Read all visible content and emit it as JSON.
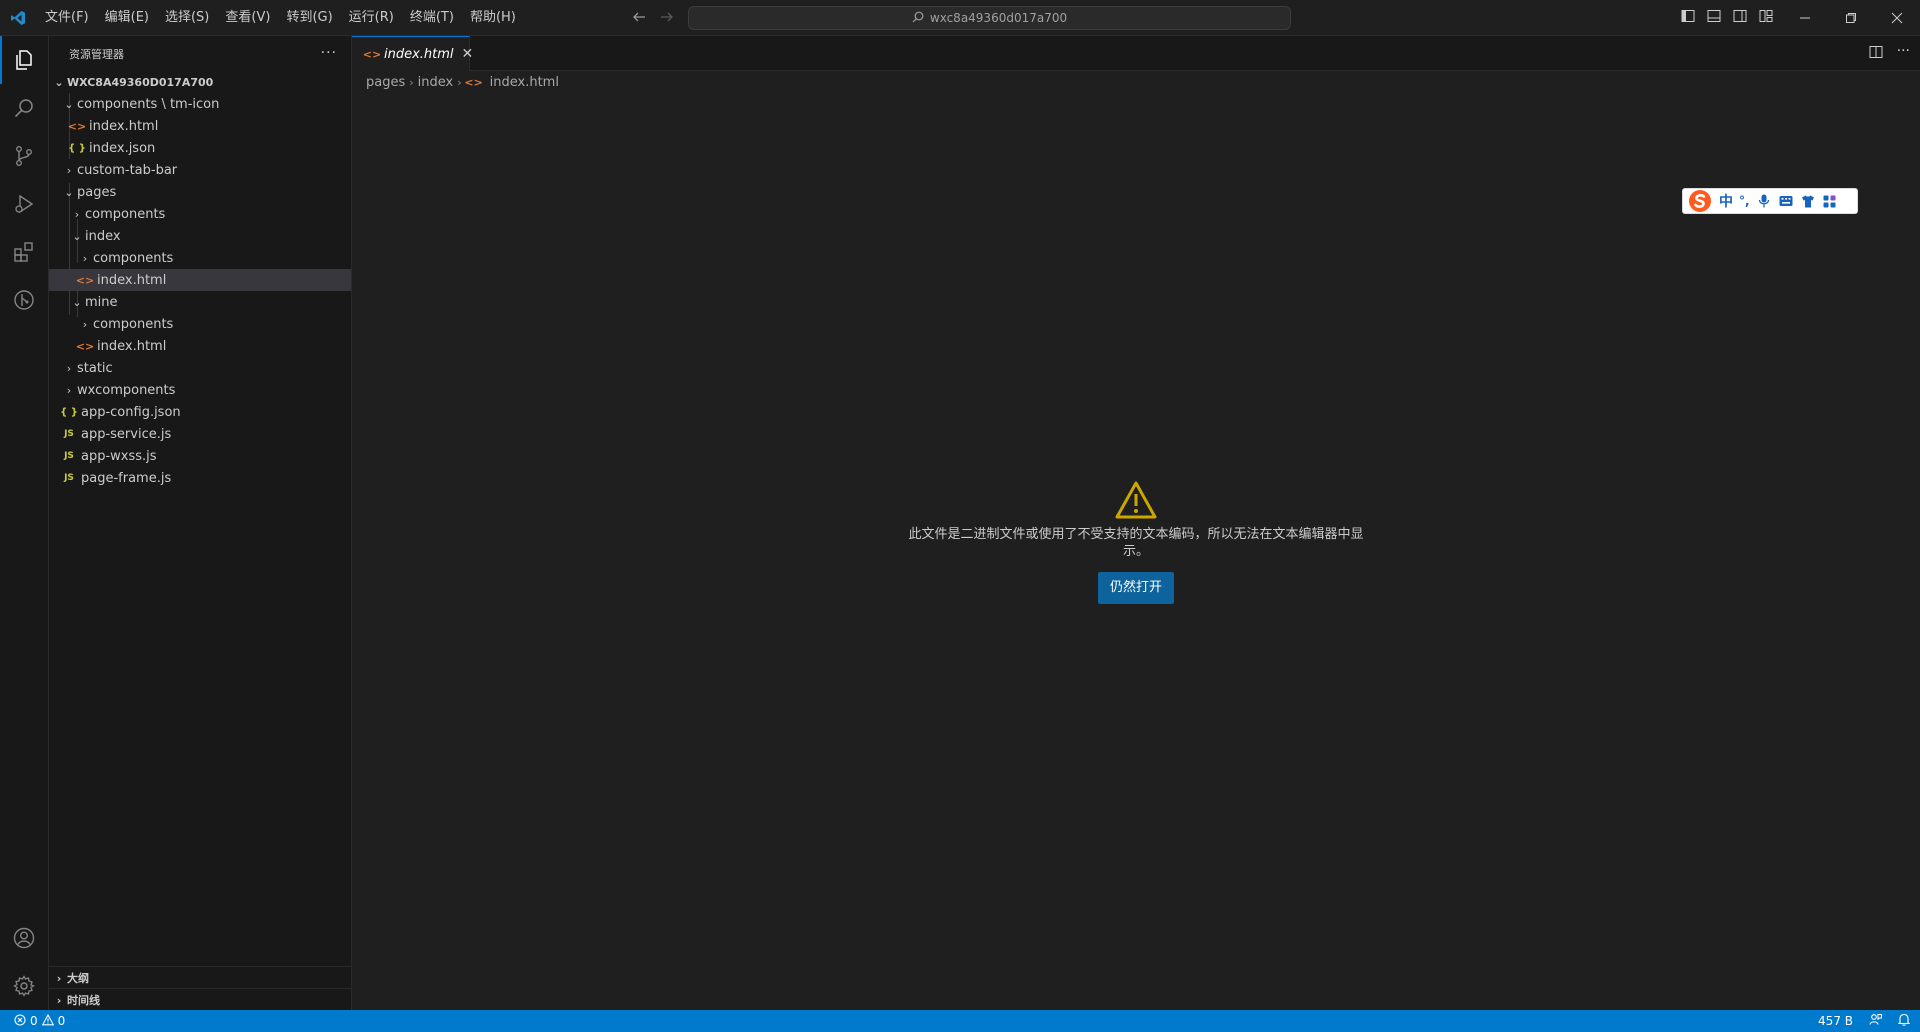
{
  "titlebar": {
    "menu": [
      "文件(F)",
      "编辑(E)",
      "选择(S)",
      "查看(V)",
      "转到(G)",
      "运行(R)",
      "终端(T)",
      "帮助(H)"
    ],
    "command_center": "wxc8a49360d017a700"
  },
  "activitybar": {
    "items": [
      "explorer-icon",
      "search-icon",
      "source-control-icon",
      "run-debug-icon",
      "extensions-icon",
      "git-graph-icon"
    ],
    "bottom": [
      "account-icon",
      "settings-icon"
    ]
  },
  "sidebar": {
    "title": "资源管理器",
    "root": "WXC8A49360D017A700",
    "tree": {
      "components_tm_icon": "components \\ tm-icon",
      "tm_icon_index_html": "index.html",
      "tm_icon_index_json": "index.json",
      "custom_tab_bar": "custom-tab-bar",
      "pages": "pages",
      "pages_components": "components",
      "pages_index": "index",
      "index_components": "components",
      "index_index_html": "index.html",
      "mine": "mine",
      "mine_components": "components",
      "mine_index_html": "index.html",
      "static": "static",
      "wxcomponents": "wxcomponents",
      "app_config_json": "app-config.json",
      "app_service_js": "app-service.js",
      "app_wxss_js": "app-wxss.js",
      "page_frame_js": "page-frame.js"
    },
    "icon_labels": {
      "json": "{ }",
      "js": "JS"
    },
    "sections": {
      "outline": "大纲",
      "timeline": "时间线"
    }
  },
  "editor": {
    "tab_label": "index.html",
    "breadcrumbs": [
      "pages",
      "index",
      "index.html"
    ],
    "message": "此文件是二进制文件或使用了不受支持的文本编码，所以无法在文本编辑器中显示。",
    "open_button": "仍然打开"
  },
  "ime": {
    "mode": "中",
    "punct": "°,"
  },
  "statusbar": {
    "errors": "0",
    "warnings": "0",
    "file_size": "457 B"
  },
  "colors": {
    "accent": "#0078d4",
    "statusbar": "#007acc",
    "button": "#0e639c",
    "warning": "#cca700"
  }
}
